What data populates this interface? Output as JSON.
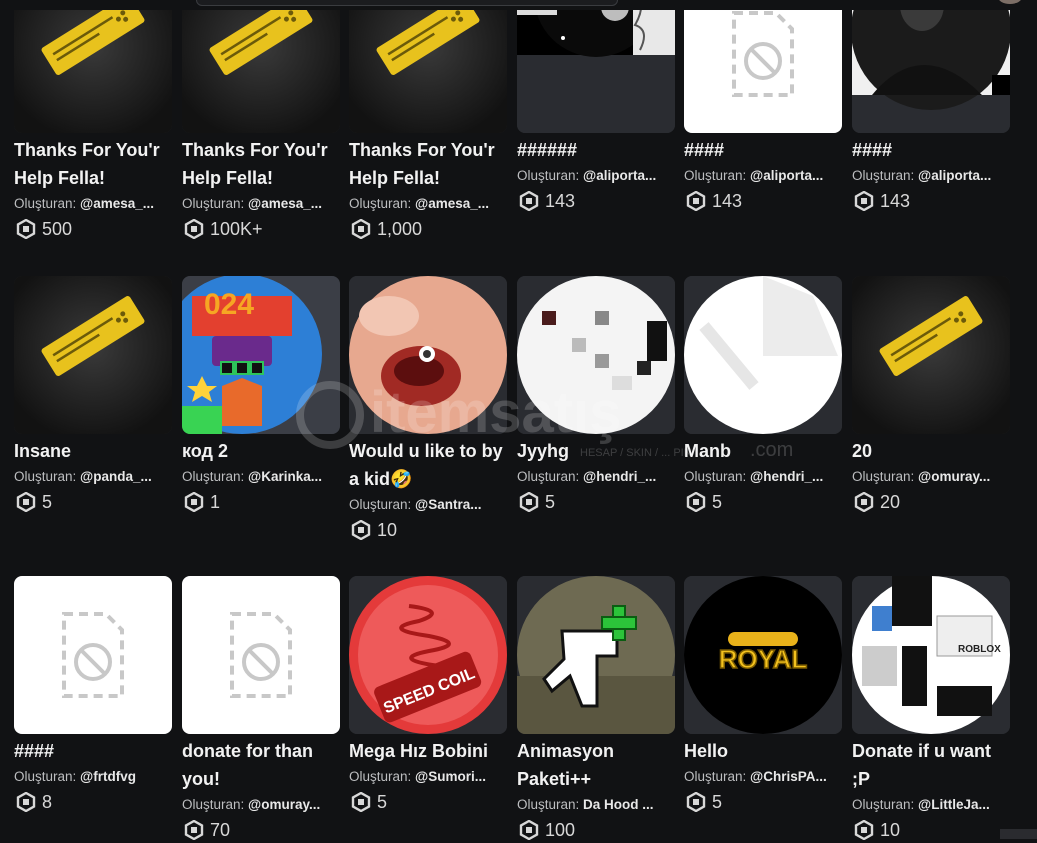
{
  "creator_prefix": "Oluşturan:",
  "items": [
    {
      "name": "Thanks For You'r Help Fella!",
      "creator": "@amesa_...",
      "price": "500",
      "thumb": "ticket-icon"
    },
    {
      "name": "Thanks For You'r Help Fella!",
      "creator": "@amesa_...",
      "price": "100K+",
      "thumb": "ticket-icon"
    },
    {
      "name": "Thanks For You'r Help Fella!",
      "creator": "@amesa_...",
      "price": "1,000",
      "thumb": "ticket-icon"
    },
    {
      "name": "######",
      "creator": "@aliporta...",
      "price": "143",
      "thumb": "sketch-image"
    },
    {
      "name": "####",
      "creator": "@aliporta...",
      "price": "143",
      "thumb": "unavailable-icon"
    },
    {
      "name": "####",
      "creator": "@aliporta...",
      "price": "143",
      "thumb": "portrait-image"
    },
    {
      "name": "Insane",
      "creator": "@panda_...",
      "price": "5",
      "thumb": "ticket-icon"
    },
    {
      "name": "код 2",
      "creator": "@Karinka...",
      "price": "1",
      "thumb": "colorful-image"
    },
    {
      "name": "Would u like to by a kid🤣",
      "creator": "@Santra...",
      "price": "10",
      "thumb": "face-image"
    },
    {
      "name": "Jyyhg",
      "creator": "@hendri_...",
      "price": "5",
      "thumb": "pixel-image"
    },
    {
      "name": "Manb",
      "creator": "@hendri_...",
      "price": "5",
      "thumb": "white-circle-image"
    },
    {
      "name": "20",
      "creator": "@omuray...",
      "price": "20",
      "thumb": "ticket-icon"
    },
    {
      "name": "####",
      "creator": "@frtdfvg",
      "price": "8",
      "thumb": "unavailable-icon"
    },
    {
      "name": "donate for than you!",
      "creator": "@omuray...",
      "price": "70",
      "thumb": "unavailable-icon"
    },
    {
      "name": "Mega Hız Bobini",
      "creator": "@Sumori...",
      "price": "5",
      "thumb": "speed-coil-image",
      "badge_text": "SPEED COIL"
    },
    {
      "name": "Animasyon Paketi++",
      "creator": "Da Hood ...",
      "price": "100",
      "thumb": "animation-image"
    },
    {
      "name": "Hello",
      "creator": "@ChrisPA...",
      "price": "5",
      "thumb": "royal-image",
      "badge_text": "ROYAL"
    },
    {
      "name": "Donate if u want ;P",
      "creator": "@LittleJa...",
      "price": "10",
      "thumb": "roblox-template-image",
      "badge_text": "ROBLOX"
    }
  ],
  "watermark": {
    "brand": "itemsatış",
    "tagline": "HESAP / SKIN / ... PIN",
    "suffix": ".com"
  }
}
